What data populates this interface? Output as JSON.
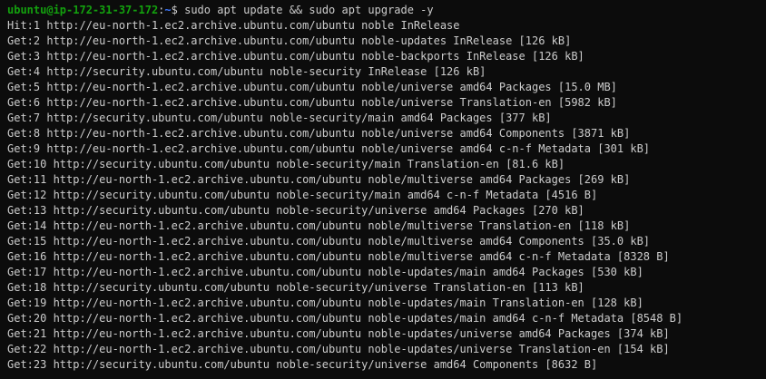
{
  "prompt": {
    "user_host": "ubuntu@ip-172-31-37-172",
    "separator": ":",
    "path": "~",
    "symbol": "$",
    "command": " sudo apt update && sudo apt upgrade -y"
  },
  "output_lines": [
    "Hit:1 http://eu-north-1.ec2.archive.ubuntu.com/ubuntu noble InRelease",
    "Get:2 http://eu-north-1.ec2.archive.ubuntu.com/ubuntu noble-updates InRelease [126 kB]",
    "Get:3 http://eu-north-1.ec2.archive.ubuntu.com/ubuntu noble-backports InRelease [126 kB]",
    "Get:4 http://security.ubuntu.com/ubuntu noble-security InRelease [126 kB]",
    "Get:5 http://eu-north-1.ec2.archive.ubuntu.com/ubuntu noble/universe amd64 Packages [15.0 MB]",
    "Get:6 http://eu-north-1.ec2.archive.ubuntu.com/ubuntu noble/universe Translation-en [5982 kB]",
    "Get:7 http://security.ubuntu.com/ubuntu noble-security/main amd64 Packages [377 kB]",
    "Get:8 http://eu-north-1.ec2.archive.ubuntu.com/ubuntu noble/universe amd64 Components [3871 kB]",
    "Get:9 http://eu-north-1.ec2.archive.ubuntu.com/ubuntu noble/universe amd64 c-n-f Metadata [301 kB]",
    "Get:10 http://security.ubuntu.com/ubuntu noble-security/main Translation-en [81.6 kB]",
    "Get:11 http://eu-north-1.ec2.archive.ubuntu.com/ubuntu noble/multiverse amd64 Packages [269 kB]",
    "Get:12 http://security.ubuntu.com/ubuntu noble-security/main amd64 c-n-f Metadata [4516 B]",
    "Get:13 http://security.ubuntu.com/ubuntu noble-security/universe amd64 Packages [270 kB]",
    "Get:14 http://eu-north-1.ec2.archive.ubuntu.com/ubuntu noble/multiverse Translation-en [118 kB]",
    "Get:15 http://eu-north-1.ec2.archive.ubuntu.com/ubuntu noble/multiverse amd64 Components [35.0 kB]",
    "Get:16 http://eu-north-1.ec2.archive.ubuntu.com/ubuntu noble/multiverse amd64 c-n-f Metadata [8328 B]",
    "Get:17 http://eu-north-1.ec2.archive.ubuntu.com/ubuntu noble-updates/main amd64 Packages [530 kB]",
    "Get:18 http://security.ubuntu.com/ubuntu noble-security/universe Translation-en [113 kB]",
    "Get:19 http://eu-north-1.ec2.archive.ubuntu.com/ubuntu noble-updates/main Translation-en [128 kB]",
    "Get:20 http://eu-north-1.ec2.archive.ubuntu.com/ubuntu noble-updates/main amd64 c-n-f Metadata [8548 B]",
    "Get:21 http://eu-north-1.ec2.archive.ubuntu.com/ubuntu noble-updates/universe amd64 Packages [374 kB]",
    "Get:22 http://eu-north-1.ec2.archive.ubuntu.com/ubuntu noble-updates/universe Translation-en [154 kB]",
    "Get:23 http://security.ubuntu.com/ubuntu noble-security/universe amd64 Components [8632 B]"
  ],
  "colors": {
    "background": "#0c0c0c",
    "text": "#cccccc",
    "prompt_user": "#13a10e",
    "prompt_path": "#3b78ff"
  }
}
